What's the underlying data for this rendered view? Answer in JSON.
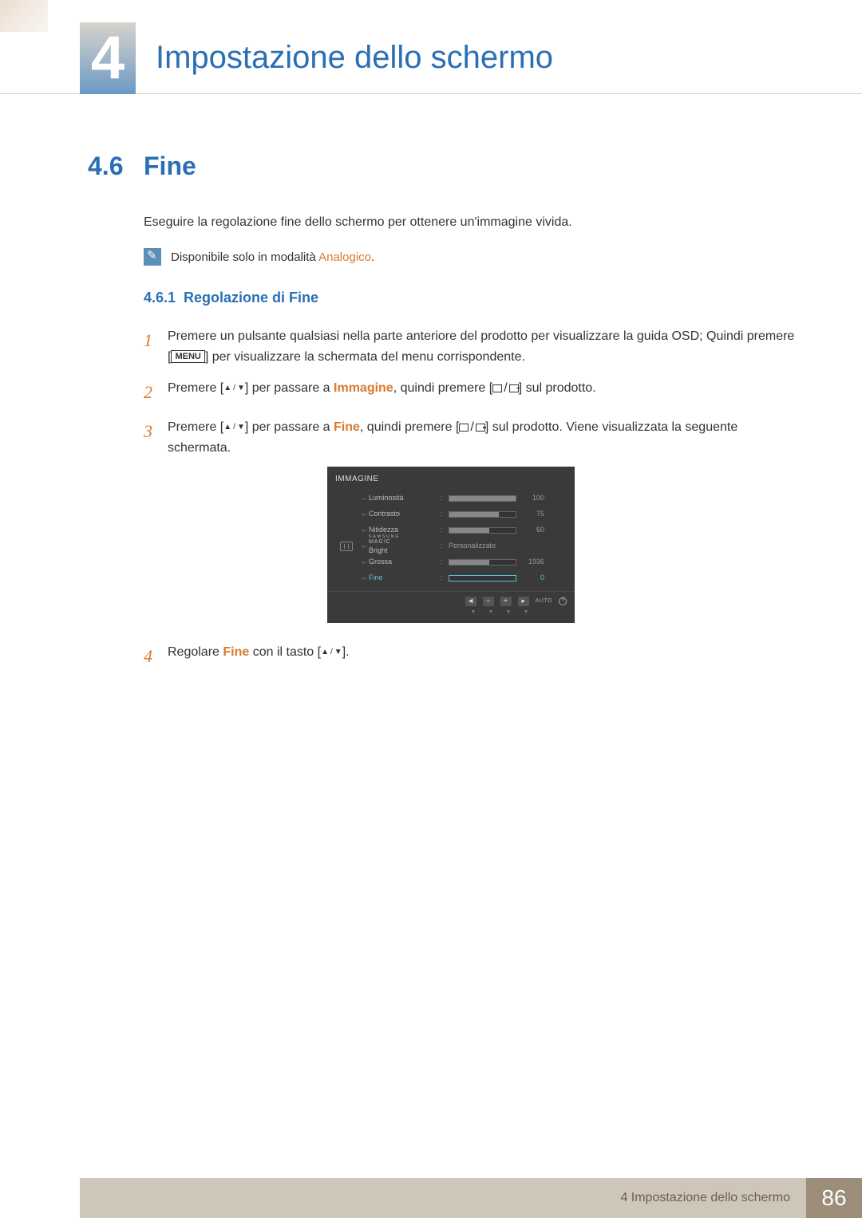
{
  "chapter": {
    "number": "4",
    "title": "Impostazione dello schermo"
  },
  "section": {
    "number": "4.6",
    "title": "Fine"
  },
  "intro": "Eseguire la regolazione fine dello schermo per ottenere un'immagine vivida.",
  "note": {
    "prefix": "Disponibile solo in modalità ",
    "highlight": "Analogico",
    "suffix": "."
  },
  "subsection": {
    "number": "4.6.1",
    "title": "Regolazione di Fine"
  },
  "steps": {
    "s1a": "Premere un pulsante qualsiasi nella parte anteriore del prodotto per visualizzare la guida OSD; Quindi premere [",
    "s1_menu": "MENU",
    "s1b": "] per visualizzare la schermata del menu corrispondente.",
    "s2a": "Premere [",
    "s2b": "] per passare a ",
    "s2_hl": "Immagine",
    "s2c": ", quindi premere [",
    "s2d": "] sul prodotto.",
    "s3a": "Premere [",
    "s3b": "] per passare a ",
    "s3_hl": "Fine",
    "s3c": ", quindi premere [",
    "s3d": "] sul prodotto. Viene visualizzata la seguente schermata.",
    "s4a": "Regolare ",
    "s4_hl": "Fine",
    "s4b": " con il tasto [",
    "s4c": "].",
    "n1": "1",
    "n2": "2",
    "n3": "3",
    "n4": "4"
  },
  "osd": {
    "title": "IMMAGINE",
    "rows": [
      {
        "label": "Luminosità",
        "value": "100",
        "fill": 100,
        "active": false,
        "type": "bar"
      },
      {
        "label": "Contrasto",
        "value": "75",
        "fill": 75,
        "active": false,
        "type": "bar"
      },
      {
        "label": "Nitidezza",
        "value": "60",
        "fill": 60,
        "active": false,
        "type": "bar"
      },
      {
        "label": "MAGIC Bright",
        "brand": "SAMSUNG",
        "text": "Personalizzato",
        "active": false,
        "type": "text"
      },
      {
        "label": "Grossa",
        "value": "1936",
        "fill": 60,
        "active": false,
        "type": "bar"
      },
      {
        "label": "Fine",
        "value": "0",
        "fill": 0,
        "active": true,
        "type": "bar"
      }
    ],
    "footer": {
      "auto": "AUTO"
    }
  },
  "footer": {
    "text": "4 Impostazione dello schermo",
    "page": "86"
  }
}
